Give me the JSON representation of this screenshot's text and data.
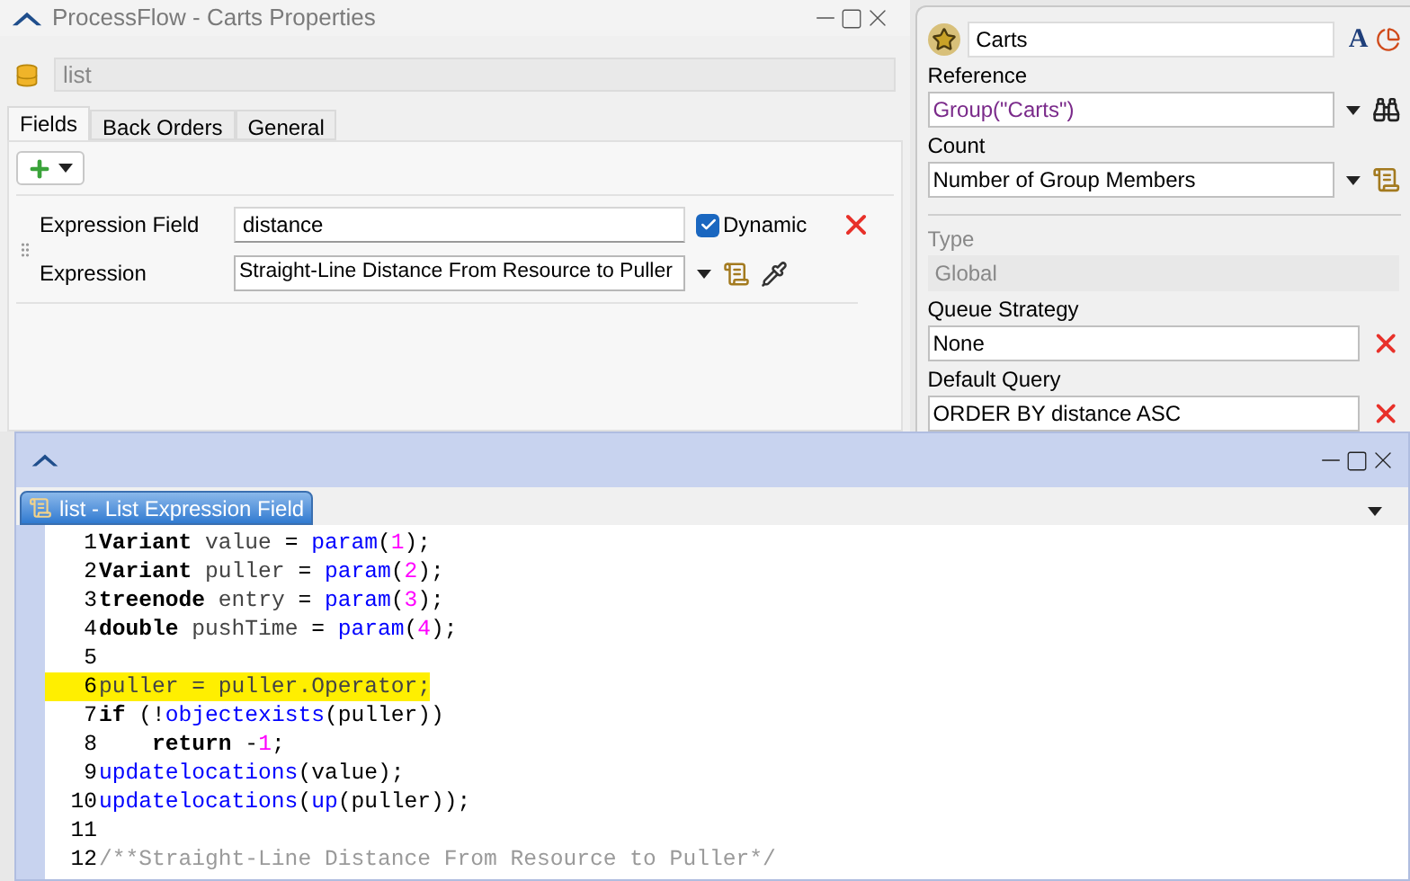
{
  "properties_window": {
    "title": "ProcessFlow - Carts Properties",
    "name": "list",
    "tabs": [
      {
        "label": "Fields",
        "selected": true
      },
      {
        "label": "Back Orders",
        "selected": false
      },
      {
        "label": "General",
        "selected": false
      }
    ],
    "field_label": "Expression Field",
    "field_value": "distance",
    "dynamic": {
      "label": "Dynamic",
      "checked": true
    },
    "expression_label": "Expression",
    "expression_value": "Straight-Line Distance From Resource to Puller"
  },
  "side_panel": {
    "name": "Carts",
    "font_button": "A",
    "fields": [
      {
        "label": "Reference",
        "value": "Group(\"Carts\")",
        "kind": "reference",
        "disabled": false
      },
      {
        "label": "Count",
        "value": "Number of Group Members",
        "kind": "picklist",
        "disabled": false
      },
      {
        "label": "Type",
        "value": "Global",
        "kind": "plain",
        "disabled": true
      },
      {
        "label": "Queue Strategy",
        "value": "None",
        "kind": "clearable",
        "disabled": false
      },
      {
        "label": "Default Query",
        "value": "ORDER BY distance ASC",
        "kind": "clearable",
        "disabled": false
      }
    ]
  },
  "editor_window": {
    "tab": "list - List Expression Field",
    "lines": [
      {
        "number": "1",
        "highlighted": false,
        "tokens": [
          {
            "text": "Variant",
            "kind": "kw"
          },
          {
            "text": " value ",
            "kind": "var"
          },
          {
            "text": "= ",
            "kind": "op"
          },
          {
            "text": "param",
            "kind": "fn"
          },
          {
            "text": "(",
            "kind": "op"
          },
          {
            "text": "1",
            "kind": "num"
          },
          {
            "text": ");",
            "kind": "op"
          }
        ]
      },
      {
        "number": "2",
        "highlighted": false,
        "tokens": [
          {
            "text": "Variant",
            "kind": "kw"
          },
          {
            "text": " puller ",
            "kind": "var"
          },
          {
            "text": "= ",
            "kind": "op"
          },
          {
            "text": "param",
            "kind": "fn"
          },
          {
            "text": "(",
            "kind": "op"
          },
          {
            "text": "2",
            "kind": "num"
          },
          {
            "text": ");",
            "kind": "op"
          }
        ]
      },
      {
        "number": "3",
        "highlighted": false,
        "tokens": [
          {
            "text": "treenode",
            "kind": "kw"
          },
          {
            "text": " entry ",
            "kind": "var"
          },
          {
            "text": "= ",
            "kind": "op"
          },
          {
            "text": "param",
            "kind": "fn"
          },
          {
            "text": "(",
            "kind": "op"
          },
          {
            "text": "3",
            "kind": "num"
          },
          {
            "text": ");",
            "kind": "op"
          }
        ]
      },
      {
        "number": "4",
        "highlighted": false,
        "tokens": [
          {
            "text": "double",
            "kind": "kw"
          },
          {
            "text": " pushTime ",
            "kind": "var"
          },
          {
            "text": "= ",
            "kind": "op"
          },
          {
            "text": "param",
            "kind": "fn"
          },
          {
            "text": "(",
            "kind": "op"
          },
          {
            "text": "4",
            "kind": "num"
          },
          {
            "text": ");",
            "kind": "op"
          }
        ]
      },
      {
        "number": "5",
        "highlighted": false
      },
      {
        "number": "6",
        "highlighted": true,
        "tokens": [
          {
            "text": "puller = puller.Operator;",
            "kind": "var"
          }
        ]
      },
      {
        "number": "7",
        "highlighted": false,
        "tokens": [
          {
            "text": "if",
            "kind": "kw"
          },
          {
            "text": " (!",
            "kind": "op"
          },
          {
            "text": "objectexists",
            "kind": "fn"
          },
          {
            "text": "(puller))",
            "kind": "op"
          }
        ]
      },
      {
        "number": "8",
        "highlighted": false,
        "tokens": [
          {
            "text": "    return",
            "kind": "kw"
          },
          {
            "text": " -",
            "kind": "op"
          },
          {
            "text": "1",
            "kind": "num"
          },
          {
            "text": ";",
            "kind": "op"
          }
        ]
      },
      {
        "number": "9",
        "highlighted": false,
        "tokens": [
          {
            "text": "updatelocations",
            "kind": "fn"
          },
          {
            "text": "(value);",
            "kind": "op"
          }
        ]
      },
      {
        "number": "10",
        "highlighted": false,
        "tokens": [
          {
            "text": "updatelocations",
            "kind": "fn"
          },
          {
            "text": "(",
            "kind": "op"
          },
          {
            "text": "up",
            "kind": "fn"
          },
          {
            "text": "(puller));",
            "kind": "op"
          }
        ]
      },
      {
        "number": "11",
        "highlighted": false
      },
      {
        "number": "12",
        "highlighted": false,
        "tokens": [
          {
            "text": "/**Straight-Line Distance From Resource to Puller*/",
            "kind": "comment"
          }
        ]
      }
    ]
  }
}
